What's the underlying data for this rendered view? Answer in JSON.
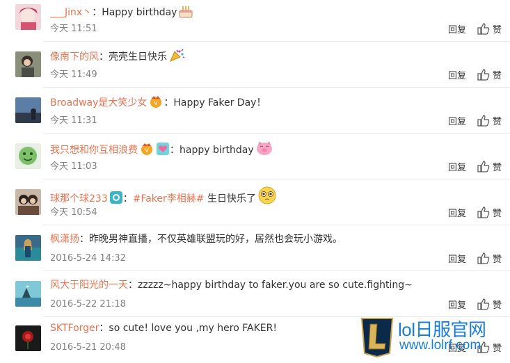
{
  "comments": [
    {
      "user": "___Jinx丶",
      "sep": "：",
      "text": "Happy birthday",
      "time": "今天 11:51",
      "reply": "回复",
      "like": "赞",
      "emoji": "cake-emoji"
    },
    {
      "user": "像南下的风",
      "sep": "：",
      "text": "壳壳生日快乐",
      "time": "今天 11:49",
      "reply": "回复",
      "like": "赞",
      "emoji": "party-popper-emoji"
    },
    {
      "user": "Broadway是大笑少女",
      "sep": "：",
      "text": "Happy Faker Day！",
      "time": "今天 11:31",
      "reply": "回复",
      "like": "赞",
      "emoji": "vip-badge-emoji"
    },
    {
      "user": "我只想和你互相浪费",
      "sep": "：",
      "text": "happy birthday",
      "time": "今天 11:03",
      "reply": "回复",
      "like": "赞",
      "emoji": "pig-emoji"
    },
    {
      "user": "球那个球233",
      "sep": "：",
      "topic": "#Faker李相赫#",
      "text": " 生日快乐了",
      "time": "今天 10:54",
      "reply": "回复",
      "like": "赞",
      "emoji": "teary-face-emoji"
    },
    {
      "user": "枫潇扬",
      "sep": "：",
      "text": "昨晚男神直播，不仅英雄联盟玩的好，居然也会玩小游戏。",
      "time": "2016-5-24 14:32",
      "reply": "回复",
      "like": "赞"
    },
    {
      "user": "风大于阳光的一天",
      "sep": "：",
      "text": "zzzzz~happy birthday to faker.you are so cute.fighting~",
      "time": "2016-5-22 21:18",
      "reply": "回复",
      "like": "赞"
    },
    {
      "user": "SKTForger",
      "sep": "：",
      "text": "so cute!  love you ,my hero FAKER!",
      "time": "2016-5-21 20:48",
      "reply": "回复",
      "like": "赞"
    }
  ],
  "watermark": {
    "title": "lol日服官网",
    "url": "www.lolrf.com"
  },
  "colors": {
    "username": "#eb7350",
    "time": "#808080",
    "text": "#333333",
    "watermark": "#1a7fd8"
  }
}
